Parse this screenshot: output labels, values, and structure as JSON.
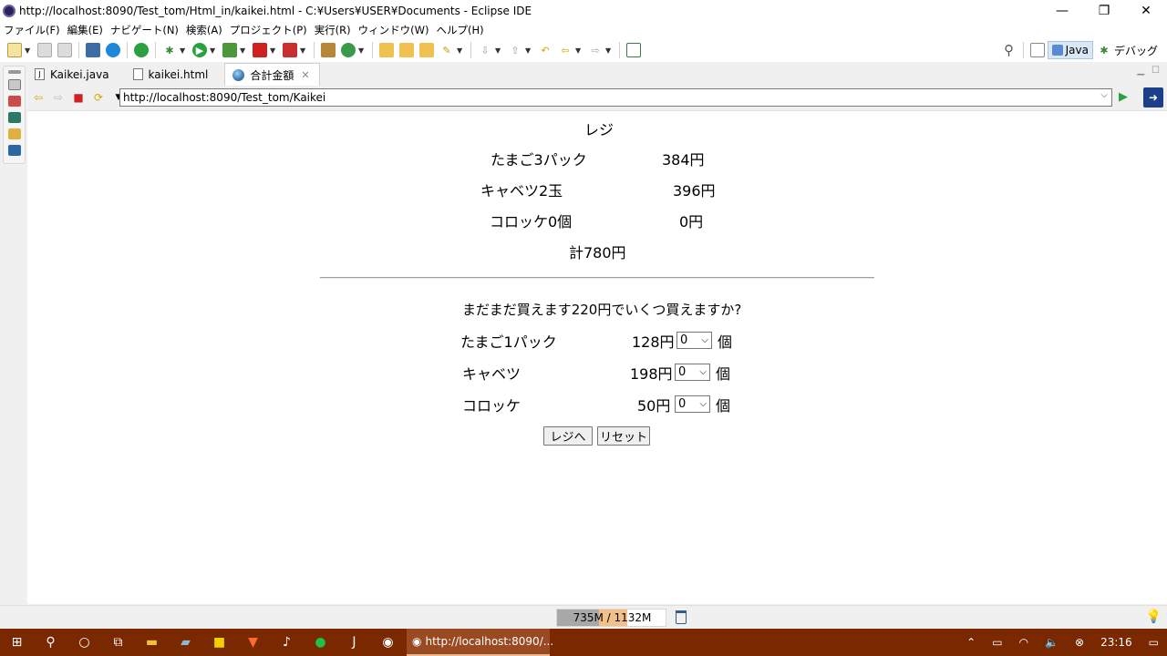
{
  "window": {
    "title": "http://localhost:8090/Test_tom/Html_in/kaikei.html - C:¥Users¥USER¥Documents - Eclipse IDE",
    "minimize": "—",
    "maximize": "❐",
    "close": "✕"
  },
  "menu": [
    "ファイル(F)",
    "編集(E)",
    "ナビゲート(N)",
    "検索(A)",
    "プロジェクト(P)",
    "実行(R)",
    "ウィンドウ(W)",
    "ヘルプ(H)"
  ],
  "perspectives": {
    "java": "Java",
    "debug": "デバッグ"
  },
  "tabs": [
    {
      "label": "Kaikei.java"
    },
    {
      "label": "kaikei.html"
    },
    {
      "label": "合計金額",
      "close": "✕"
    }
  ],
  "browser": {
    "url": "http://localhost:8090/Test_tom/Kaikei"
  },
  "page": {
    "title": "レジ",
    "purchased": [
      {
        "item": "たまご3パック",
        "price": "384円"
      },
      {
        "item": "キャベツ2玉",
        "price": "396円"
      },
      {
        "item": "コロッケ0個",
        "price": "0円"
      }
    ],
    "total": "計780円",
    "question": "まだまだ買えます220円でいくつ買えますか?",
    "options": [
      {
        "item": "たまご1パック",
        "price": "128円",
        "qty": "0",
        "unit": "個"
      },
      {
        "item": "キャベツ",
        "price": "198円",
        "qty": "0",
        "unit": "個"
      },
      {
        "item": "コロッケ",
        "price": "50円",
        "qty": "0",
        "unit": "個"
      }
    ],
    "submit_label": "レジへ",
    "reset_label": "リセット"
  },
  "status": {
    "heap": "735M / 1132M",
    "heap_used_fraction": 0.65
  },
  "taskbar": {
    "active_app": "http://localhost:8090/...",
    "time": "23:16"
  },
  "colors": {
    "taskbar": "#7a2800",
    "accent": "#1c3f8a"
  }
}
